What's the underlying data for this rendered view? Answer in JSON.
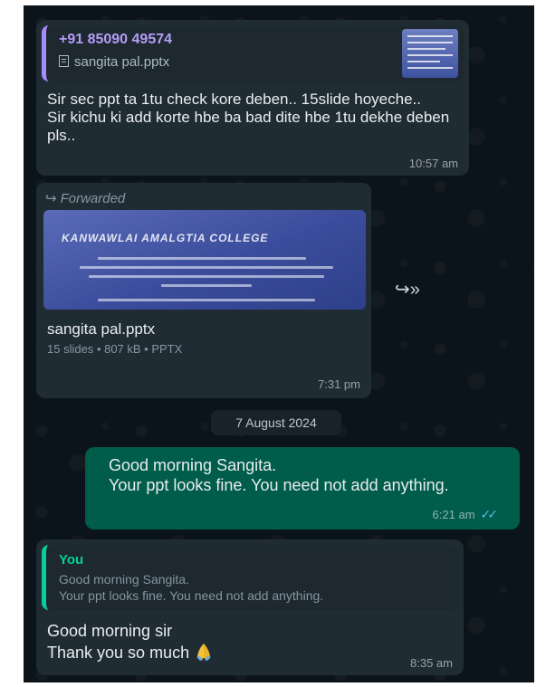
{
  "message1": {
    "quote_sender": "+91 85090 49574",
    "quote_file": "sangita pal.pptx",
    "text": "Sir sec ppt ta 1tu check kore deben.. 15slide hoyeche..\nSir kichu ki add korte hbe ba bad dite hbe 1tu dekhe deben pls..",
    "time": "10:57 am"
  },
  "message2": {
    "forwarded_label": "Forwarded",
    "preview_heading": "KANWAWLAI AMALGTIA COLLEGE",
    "file_name": "sangita pal.pptx",
    "file_meta": "15 slides • 807 kB • PPTX",
    "time": "7:31 pm"
  },
  "date_chip": "7 August 2024",
  "message3": {
    "text": "Good morning Sangita.\nYour ppt looks fine. You need not add anything.",
    "time": "6:21 am",
    "status_icon": "double-check-read-icon"
  },
  "message4": {
    "quote_sender": "You",
    "quote_text": "Good morning Sangita.\nYour ppt looks fine. You need not add anything.",
    "text": "Good morning sir\nThank you so much",
    "time": "8:35 am",
    "emoji": "folded-hands"
  },
  "colors": {
    "background": "#0b141a",
    "incoming_bubble": "#202c33",
    "outgoing_bubble": "#005c4b",
    "quote_accent_purple": "#a78bfa",
    "quote_accent_green": "#06cf9c",
    "read_ticks": "#53bdeb"
  }
}
